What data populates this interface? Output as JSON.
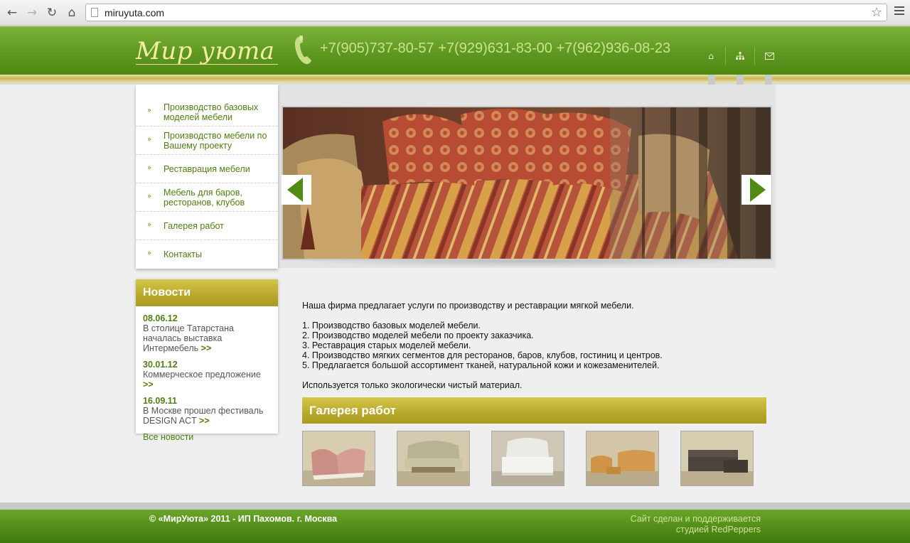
{
  "browser": {
    "url": "miruyuta.com"
  },
  "header": {
    "logo": "Мир уюта",
    "phones": "+7(905)737-80-57 +7(929)631-83-00 +7(962)936-08-23",
    "icons": [
      "home-icon",
      "sitemap-icon",
      "mail-icon"
    ]
  },
  "menu": {
    "items": [
      {
        "label": "Производство базовых моделей мебели"
      },
      {
        "label": "Производство мебели по Вашему проекту"
      },
      {
        "label": "Реставрация мебели"
      },
      {
        "label": "Мебель для баров, ресторанов, клубов"
      },
      {
        "label": "Галерея работ"
      },
      {
        "label": "Контакты"
      }
    ]
  },
  "news": {
    "title": "Новости",
    "items": [
      {
        "date": "08.06.12",
        "text": "В столице Татарстана началась выставка Интермебель",
        "more": ">>"
      },
      {
        "date": "30.01.12",
        "text": "Коммерческое предложение",
        "more": ">>"
      },
      {
        "date": "16.09.11",
        "text": "В Москве прошел фестиваль DESIGN ACT",
        "more": ">>"
      }
    ],
    "all_link": "Все новости"
  },
  "content": {
    "intro": "Наша фирма предлагает услуги по производству и реставрации мягкой мебели.",
    "list": [
      "1. Производство базовых моделей мебели.",
      "2. Производство моделей мебели по проекту заказчика.",
      "3. Реставрация старых моделей мебели.",
      "4. Производство мягких сегментов для ресторанов, баров, клубов, гостиниц и центров.",
      "5. Предлагается большой ассортимент тканей, натуральной кожи и кожезаменителей."
    ],
    "outro": "Используется только экологически чистый материал."
  },
  "gallery": {
    "title": "Галерея работ"
  },
  "footer": {
    "copyright": "© «МирУюта» 2011 - ИП Пахомов. г. Москва",
    "credit_line1": "Сайт сделан и поддерживается",
    "credit_line2": "студией RedPeppers"
  },
  "colors": {
    "header_green": "#5f9821",
    "gold": "#b8a82c",
    "link_green": "#4f7f12"
  }
}
